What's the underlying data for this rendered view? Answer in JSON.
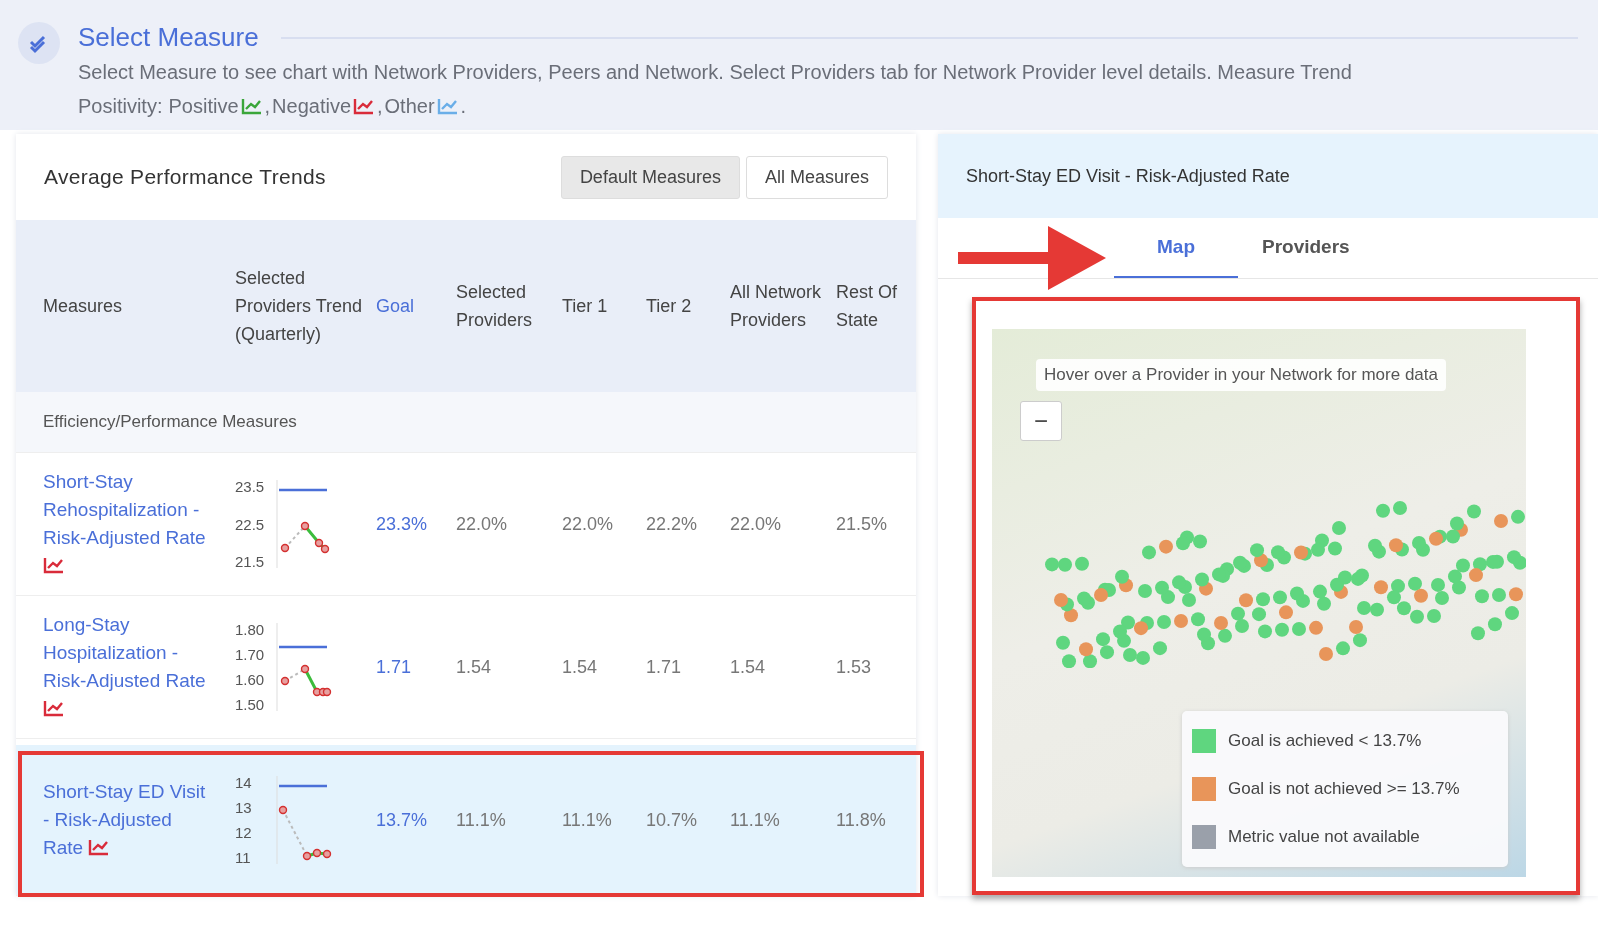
{
  "header": {
    "title": "Select Measure",
    "description": "Select Measure to see chart with Network Providers, Peers and Network. Select Providers tab for Network Provider level details. Measure Trend",
    "positivity_label": "Positivity:",
    "positivity": [
      {
        "label": "Positive",
        "kind": "positive",
        "suffix": ","
      },
      {
        "label": "Negative",
        "kind": "negative",
        "suffix": ","
      },
      {
        "label": "Other",
        "kind": "other",
        "suffix": "."
      }
    ]
  },
  "trends_panel": {
    "title": "Average Performance Trends",
    "buttons": [
      {
        "label": "Default Measures",
        "selected": true
      },
      {
        "label": "All Measures",
        "selected": false
      }
    ],
    "columns": [
      "Measures",
      "Selected Providers Trend (Quarterly)",
      "Goal",
      "Selected Providers",
      "Tier 1",
      "Tier 2",
      "All Network Providers",
      "Rest Of State"
    ],
    "section": "Efficiency/Performance Measures",
    "rows": [
      {
        "measure": "Short-Stay Rehospitalization - Risk-Adjusted Rate",
        "kind": "negative",
        "selected": false,
        "trend_ticks": [
          "23.5",
          "22.5",
          "21.5"
        ],
        "goal": "23.3%",
        "values": [
          "22.0%",
          "22.0%",
          "22.2%",
          "22.0%",
          "21.5%"
        ]
      },
      {
        "measure": "Long-Stay Hospitalization - Risk-Adjusted Rate",
        "kind": "negative",
        "selected": false,
        "trend_ticks": [
          "1.80",
          "1.70",
          "1.60",
          "1.50"
        ],
        "goal": "1.71",
        "values": [
          "1.54",
          "1.54",
          "1.71",
          "1.54",
          "1.53"
        ]
      },
      {
        "measure": "Short-Stay ED Visit - Risk-Adjusted Rate",
        "kind": "negative",
        "selected": true,
        "trend_ticks": [
          "14",
          "13",
          "12",
          "11"
        ],
        "goal": "13.7%",
        "values": [
          "11.1%",
          "11.1%",
          "10.7%",
          "11.1%",
          "11.8%"
        ]
      }
    ]
  },
  "detail_panel": {
    "title": "Short-Stay ED Visit - Risk-Adjusted Rate",
    "tabs": [
      {
        "label": "Map",
        "selected": true
      },
      {
        "label": "Providers",
        "selected": false
      }
    ],
    "map": {
      "zoom_out": "−",
      "hint": "Hover over a Provider in your Network for more data",
      "legend": [
        {
          "label": "Goal is achieved < 13.7%",
          "color": "#5fd67f"
        },
        {
          "label": "Goal is not achieved >= 13.7%",
          "color": "#e8955a"
        },
        {
          "label": "Metric value not available",
          "color": "#9aa0aa"
        }
      ]
    }
  }
}
